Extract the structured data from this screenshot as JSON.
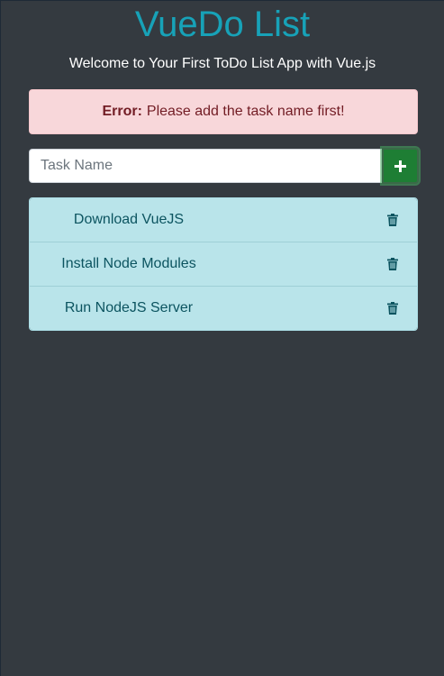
{
  "header": {
    "title": "VueDo List",
    "subtitle": "Welcome to Your First ToDo List App with Vue.js"
  },
  "alert": {
    "label": "Error:",
    "message": "Please add the task name first!"
  },
  "task_input": {
    "value": "",
    "placeholder": "Task Name"
  },
  "add_button": {
    "icon": "plus-icon"
  },
  "tasks": [
    {
      "name": "Download VueJS",
      "icon": "trash-icon"
    },
    {
      "name": "Install Node Modules",
      "icon": "trash-icon"
    },
    {
      "name": "Run NodeJS Server",
      "icon": "trash-icon"
    }
  ],
  "colors": {
    "background": "#343a40",
    "title": "#17a2b8",
    "alert_bg": "#f8d7da",
    "alert_text": "#721c24",
    "add_button": "#1e7e34",
    "list_bg": "#b9e4ea",
    "list_text": "#0c5460"
  }
}
